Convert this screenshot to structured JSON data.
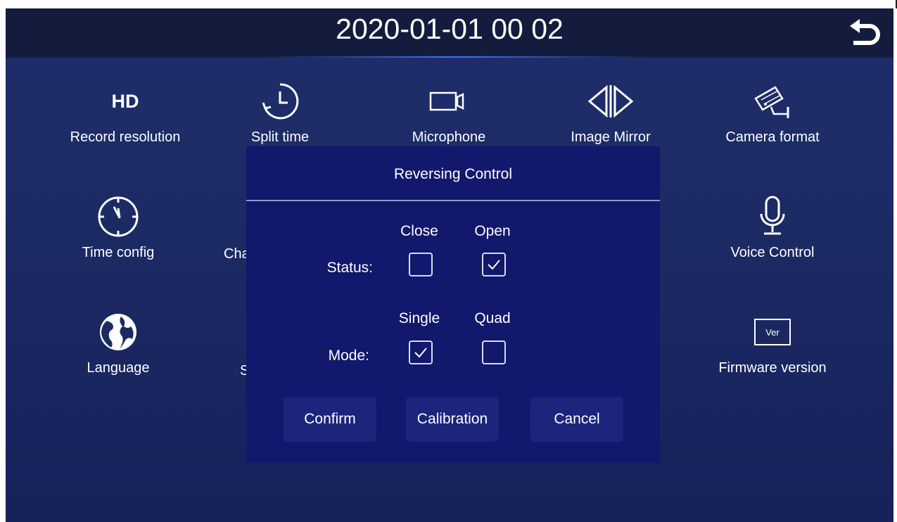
{
  "header": {
    "datetime": "2020-01-01  00 02"
  },
  "icons": {
    "back": "back-arrow-icon",
    "hd_text": "HD",
    "ver_text": "Ver"
  },
  "menu": [
    {
      "label": "Record resolution",
      "icon": "hd-icon"
    },
    {
      "label": "Split time",
      "icon": "clock-icon"
    },
    {
      "label": "Microphone",
      "icon": "camcorder-icon"
    },
    {
      "label": "Image Mirror",
      "icon": "mirror-icon"
    },
    {
      "label": "Camera format",
      "icon": "security-camera-icon"
    },
    {
      "label": "Time config",
      "icon": "clock-icon"
    },
    {
      "label": "Cha",
      "icon": ""
    },
    {
      "label": "Voice Control",
      "icon": "microphone-icon"
    },
    {
      "label": "Language",
      "icon": "globe-icon"
    },
    {
      "label": "S",
      "icon": ""
    },
    {
      "label": "Firmware version",
      "icon": "version-icon"
    }
  ],
  "dialog": {
    "title": "Reversing Control",
    "status_label": "Status:",
    "status_options": [
      {
        "label": "Close",
        "checked": false
      },
      {
        "label": "Open",
        "checked": true
      }
    ],
    "mode_label": "Mode:",
    "mode_options": [
      {
        "label": "Single",
        "checked": true
      },
      {
        "label": "Quad",
        "checked": false
      }
    ],
    "buttons": {
      "confirm": "Confirm",
      "calibration": "Calibration",
      "cancel": "Cancel"
    }
  },
  "colors": {
    "background": "#1c2a64",
    "header": "#141c3e",
    "dialog": "#12186b",
    "button": "#1c247c"
  }
}
